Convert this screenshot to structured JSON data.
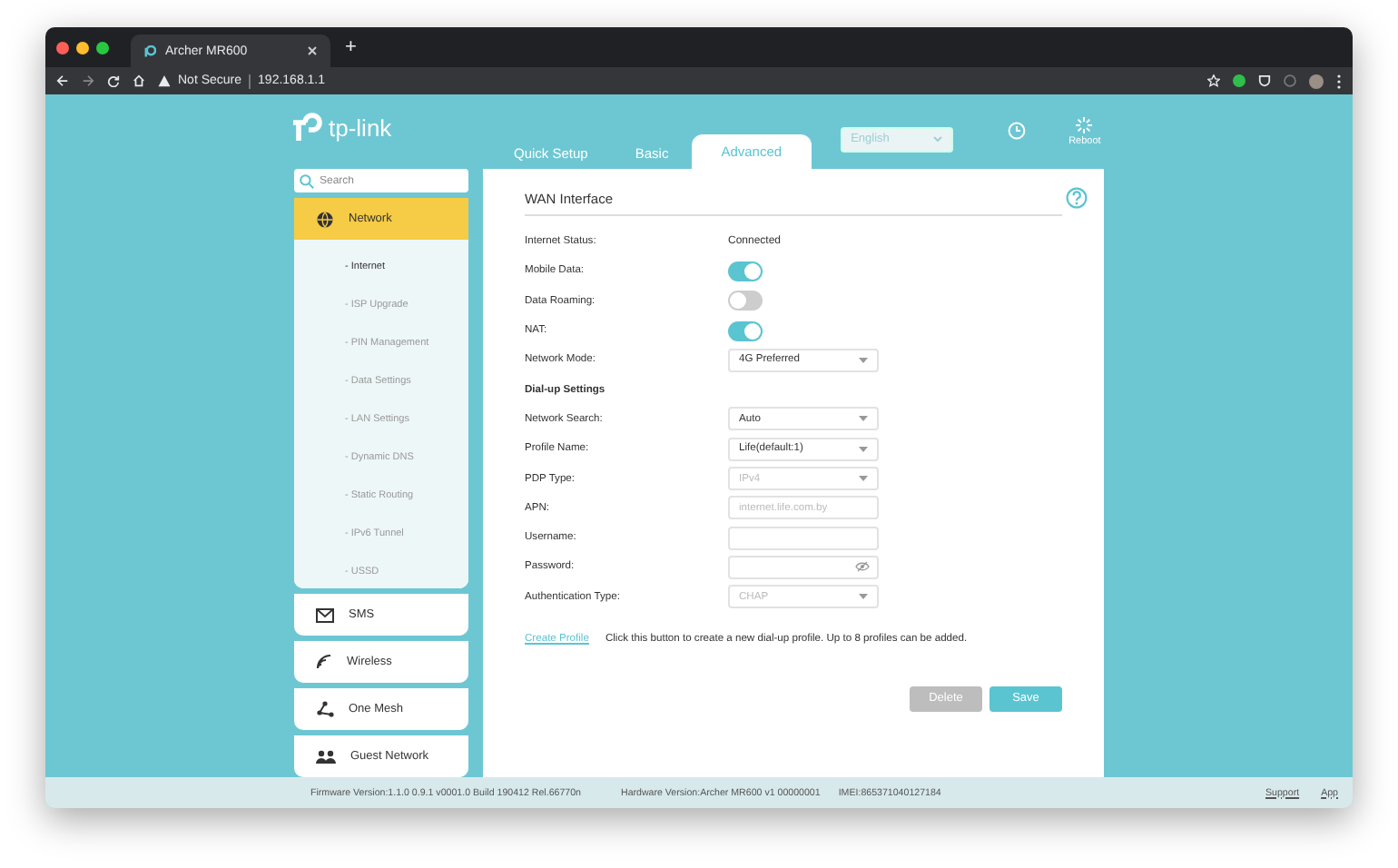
{
  "browser": {
    "tab_title": "Archer MR600",
    "new_tab": "+",
    "security": "Not Secure",
    "url": "192.168.1.1"
  },
  "header": {
    "logo": "tp-link",
    "tabs": [
      {
        "label": "Quick Setup",
        "selected": false
      },
      {
        "label": "Basic",
        "selected": false
      },
      {
        "label": "Advanced",
        "selected": true
      }
    ],
    "language": "English",
    "reboot": "Reboot"
  },
  "sidebar": {
    "search_placeholder": "Search",
    "items": [
      {
        "label": "Network",
        "selected": true,
        "expanded": true,
        "children": [
          {
            "label": "- Internet",
            "selected": true
          },
          {
            "label": "- ISP Upgrade",
            "selected": false
          },
          {
            "label": "- PIN Management",
            "selected": false
          },
          {
            "label": "- Data Settings",
            "selected": false
          },
          {
            "label": "- LAN Settings",
            "selected": false
          },
          {
            "label": "- Dynamic DNS",
            "selected": false
          },
          {
            "label": "- Static Routing",
            "selected": false
          },
          {
            "label": "- IPv6 Tunnel",
            "selected": false
          },
          {
            "label": "- USSD",
            "selected": false
          }
        ]
      },
      {
        "label": "SMS",
        "selected": false
      },
      {
        "label": "Wireless",
        "selected": false
      },
      {
        "label": "One Mesh",
        "selected": false
      },
      {
        "label": "Guest Network",
        "selected": false
      }
    ]
  },
  "panel": {
    "title": "WAN Interface",
    "rows": [
      {
        "kind": "text",
        "label": "Internet Status:",
        "value": "Connected"
      },
      {
        "kind": "toggle",
        "label": "Mobile Data:",
        "on": true
      },
      {
        "kind": "toggle",
        "label": "Data Roaming:",
        "on": false
      },
      {
        "kind": "toggle",
        "label": "NAT:",
        "on": true
      },
      {
        "kind": "select",
        "label": "Network Mode:",
        "value": "4G Preferred",
        "disabled": false
      },
      {
        "kind": "heading",
        "label": "Dial-up Settings"
      },
      {
        "kind": "select",
        "label": "Network Search:",
        "value": "Auto",
        "disabled": false
      },
      {
        "kind": "select",
        "label": "Profile Name:",
        "value": "Life(default:1)",
        "disabled": false
      },
      {
        "kind": "select",
        "label": "PDP Type:",
        "value": "IPv4",
        "disabled": true
      },
      {
        "kind": "input",
        "label": "APN:",
        "placeholder": "internet.life.com.by"
      },
      {
        "kind": "input",
        "label": "Username:"
      },
      {
        "kind": "password",
        "label": "Password:"
      },
      {
        "kind": "select",
        "label": "Authentication Type:",
        "value": "CHAP",
        "disabled": true
      }
    ],
    "create_link": "Create Profile",
    "create_note": "Click this button to create a new dial-up profile. Up to 8 profiles can be added.",
    "buttons": [
      {
        "label": "Delete",
        "disabled": true
      },
      {
        "label": "Save",
        "disabled": false
      }
    ]
  },
  "footer": {
    "firmware": "Firmware Version:1.1.0 0.9.1 v0001.0 Build 190412 Rel.66770n",
    "hardware": "Hardware Version:Archer MR600 v1 00000001",
    "imei": "IMEI:865371040127184",
    "links": [
      "Support",
      "App"
    ]
  }
}
